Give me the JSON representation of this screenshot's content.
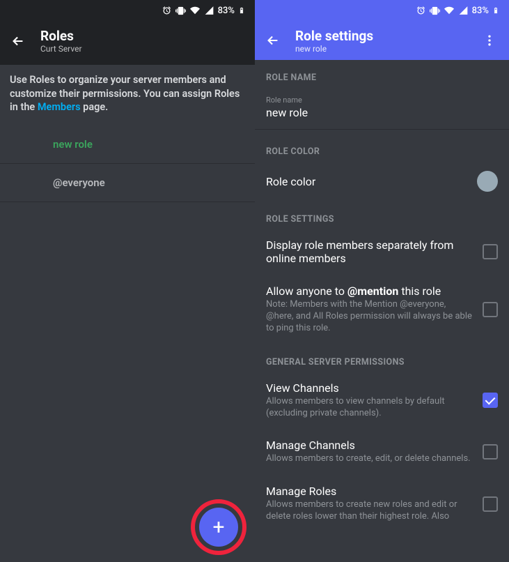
{
  "statusbar": {
    "battery": "83%"
  },
  "left": {
    "title": "Roles",
    "subtitle": "Curt Server",
    "intro_pre": "Use Roles to organize your server members and customize their permissions. You can assign Roles in the ",
    "intro_link": "Members",
    "intro_post": " page.",
    "roles": [
      {
        "name": "new role",
        "cls": "new"
      },
      {
        "name": "@everyone",
        "cls": "everyone"
      }
    ],
    "fab": "+"
  },
  "right": {
    "title": "Role settings",
    "subtitle": "new role",
    "sections": {
      "role_name_header": "ROLE NAME",
      "role_name_label": "Role name",
      "role_name_value": "new role",
      "role_color_header": "ROLE COLOR",
      "role_color_label": "Role color",
      "role_settings_header": "ROLE SETTINGS",
      "display_sep": "Display role members separately from online members",
      "mention_title_pre": "Allow anyone to ",
      "mention_title_bold": "@mention",
      "mention_title_post": " this role",
      "mention_desc": "Note: Members with the Mention @everyone, @here, and All Roles permission will always be able to ping this role.",
      "general_perms_header": "GENERAL SERVER PERMISSIONS",
      "view_channels_title": "View Channels",
      "view_channels_desc": "Allows members to view channels by default (excluding private channels).",
      "manage_channels_title": "Manage Channels",
      "manage_channels_desc": "Allows members to create, edit, or delete channels.",
      "manage_roles_title": "Manage Roles",
      "manage_roles_desc": "Allows members to create new roles and edit or delete roles lower than their highest role. Also"
    }
  }
}
